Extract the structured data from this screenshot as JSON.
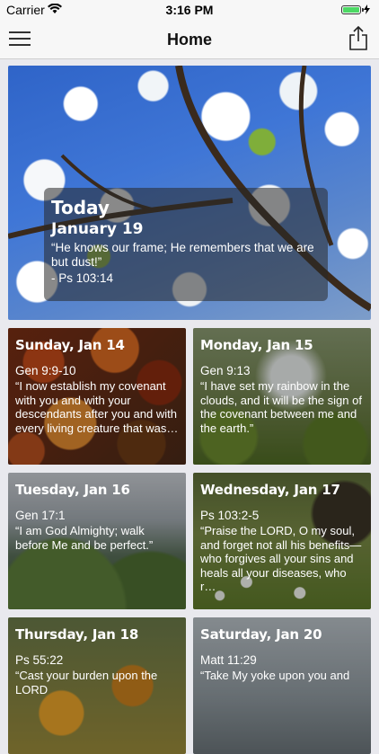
{
  "status_bar": {
    "carrier": "Carrier",
    "time": "3:16 PM"
  },
  "nav": {
    "title": "Home"
  },
  "hero": {
    "heading": "Today",
    "date": "January 19",
    "quote": "“He knows our frame; He remembers that we are but dust!”",
    "reference": "- Ps 103:14"
  },
  "cards": [
    {
      "day": "Sunday, Jan 14",
      "reference": "Gen 9:9-10",
      "verse": "“I now establish my covenant with you and with your descendants after you and with every living creature that was…"
    },
    {
      "day": "Monday, Jan 15",
      "reference": "Gen 9:13",
      "verse": "“I have set my rainbow in the clouds, and it will be the sign of the covenant between me and the earth.”"
    },
    {
      "day": "Tuesday, Jan 16",
      "reference": "Gen 17:1",
      "verse": "“I am God Almighty; walk before Me and be perfect.”"
    },
    {
      "day": "Wednesday, Jan 17",
      "reference": "Ps 103:2-5",
      "verse": "“Praise the LORD, O my soul, and forget not all his benefits—who forgives all your sins and heals all your diseases, who r…"
    },
    {
      "day": "Thursday, Jan 18",
      "reference": "Ps 55:22",
      "verse": "“Cast your burden upon the LORD"
    },
    {
      "day": "Saturday, Jan 20",
      "reference": "Matt 11:29",
      "verse": "“Take My yoke upon you and"
    }
  ]
}
